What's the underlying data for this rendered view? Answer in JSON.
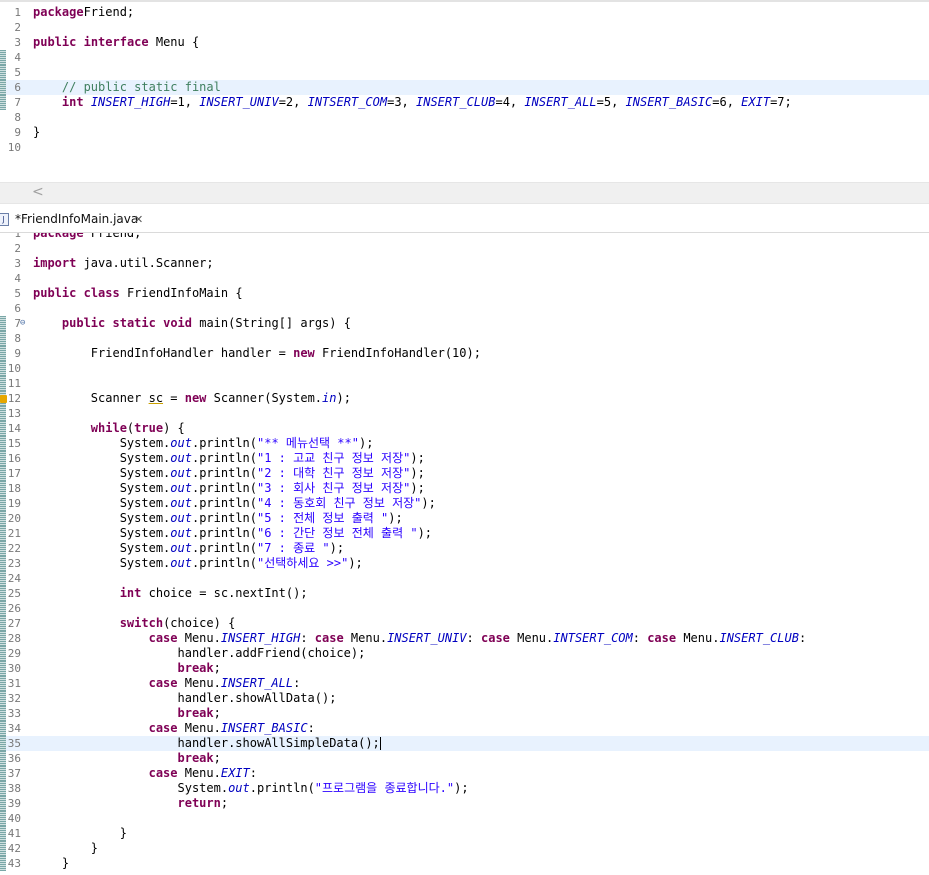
{
  "editor1": {
    "lines": [
      [
        [
          "kw",
          "package"
        ],
        [
          "",
          "Friend;"
        ]
      ],
      [],
      [
        [
          "kw",
          "public"
        ],
        [
          "",
          " "
        ],
        [
          "kw",
          "interface"
        ],
        [
          "",
          " Menu {"
        ]
      ],
      [],
      [],
      [
        [
          "",
          "    "
        ],
        [
          "cmt",
          "// public static final"
        ]
      ],
      [
        [
          "",
          "    "
        ],
        [
          "kw",
          "int"
        ],
        [
          "",
          " "
        ],
        [
          "fld",
          "INSERT_HIGH"
        ],
        [
          "",
          "=1, "
        ],
        [
          "fld",
          "INSERT_UNIV"
        ],
        [
          "",
          "=2, "
        ],
        [
          "fld",
          "INTSERT_COM"
        ],
        [
          "",
          "=3, "
        ],
        [
          "fld",
          "INSERT_CLUB"
        ],
        [
          "",
          "=4, "
        ],
        [
          "fld",
          "INSERT_ALL"
        ],
        [
          "",
          "=5, "
        ],
        [
          "fld",
          "INSERT_BASIC"
        ],
        [
          "",
          "=6, "
        ],
        [
          "fld",
          "EXIT"
        ],
        [
          "",
          "=7;"
        ]
      ],
      [],
      [
        [
          "",
          "}"
        ]
      ],
      []
    ]
  },
  "tab": {
    "file_label": "*FriendInfoMain.java",
    "file_icon": "J",
    "close_glyph": "✕"
  },
  "scroll": {
    "left_arrow": "<"
  },
  "editor2": {
    "lines": [
      [
        [
          "kw",
          "package"
        ],
        [
          "",
          " Friend;"
        ]
      ],
      [],
      [
        [
          "kw",
          "import"
        ],
        [
          "",
          " java.util.Scanner;"
        ]
      ],
      [],
      [
        [
          "kw",
          "public"
        ],
        [
          "",
          " "
        ],
        [
          "kw",
          "class"
        ],
        [
          "",
          " FriendInfoMain {"
        ]
      ],
      [],
      [
        [
          "",
          "    "
        ],
        [
          "kw",
          "public"
        ],
        [
          "",
          " "
        ],
        [
          "kw",
          "static"
        ],
        [
          "",
          " "
        ],
        [
          "kw",
          "void"
        ],
        [
          "",
          " main(String[] args) {"
        ]
      ],
      [],
      [
        [
          "",
          "        FriendInfoHandler handler = "
        ],
        [
          "kw",
          "new"
        ],
        [
          "",
          " FriendInfoHandler(10);"
        ]
      ],
      [],
      [],
      [
        [
          "",
          "        Scanner "
        ],
        [
          "ul",
          "sc"
        ],
        [
          "",
          " = "
        ],
        [
          "kw",
          "new"
        ],
        [
          "",
          " Scanner(System."
        ],
        [
          "fld",
          "in"
        ],
        [
          "",
          ");"
        ]
      ],
      [],
      [
        [
          "",
          "        "
        ],
        [
          "kw",
          "while"
        ],
        [
          "",
          "("
        ],
        [
          "kw",
          "true"
        ],
        [
          "",
          ") {"
        ]
      ],
      [
        [
          "",
          "            System."
        ],
        [
          "fld",
          "out"
        ],
        [
          "",
          ".println("
        ],
        [
          "str",
          "\"** 메뉴선택 **\""
        ],
        [
          "",
          ");"
        ]
      ],
      [
        [
          "",
          "            System."
        ],
        [
          "fld",
          "out"
        ],
        [
          "",
          ".println("
        ],
        [
          "str",
          "\"1 : 고교 친구 정보 저장\""
        ],
        [
          "",
          ");"
        ]
      ],
      [
        [
          "",
          "            System."
        ],
        [
          "fld",
          "out"
        ],
        [
          "",
          ".println("
        ],
        [
          "str",
          "\"2 : 대학 친구 정보 저장\""
        ],
        [
          "",
          ");"
        ]
      ],
      [
        [
          "",
          "            System."
        ],
        [
          "fld",
          "out"
        ],
        [
          "",
          ".println("
        ],
        [
          "str",
          "\"3 : 회사 친구 정보 저장\""
        ],
        [
          "",
          ");"
        ]
      ],
      [
        [
          "",
          "            System."
        ],
        [
          "fld",
          "out"
        ],
        [
          "",
          ".println("
        ],
        [
          "str",
          "\"4 : 동호회 친구 정보 저장\""
        ],
        [
          "",
          ");"
        ]
      ],
      [
        [
          "",
          "            System."
        ],
        [
          "fld",
          "out"
        ],
        [
          "",
          ".println("
        ],
        [
          "str",
          "\"5 : 전체 정보 출력 \""
        ],
        [
          "",
          ");"
        ]
      ],
      [
        [
          "",
          "            System."
        ],
        [
          "fld",
          "out"
        ],
        [
          "",
          ".println("
        ],
        [
          "str",
          "\"6 : 간단 정보 전체 출력 \""
        ],
        [
          "",
          ");"
        ]
      ],
      [
        [
          "",
          "            System."
        ],
        [
          "fld",
          "out"
        ],
        [
          "",
          ".println("
        ],
        [
          "str",
          "\"7 : 종료 \""
        ],
        [
          "",
          ");"
        ]
      ],
      [
        [
          "",
          "            System."
        ],
        [
          "fld",
          "out"
        ],
        [
          "",
          ".println("
        ],
        [
          "str",
          "\"선택하세요 >>\""
        ],
        [
          "",
          ");"
        ]
      ],
      [],
      [
        [
          "",
          "            "
        ],
        [
          "kw",
          "int"
        ],
        [
          "",
          " choice = sc.nextInt();"
        ]
      ],
      [],
      [
        [
          "",
          "            "
        ],
        [
          "kw",
          "switch"
        ],
        [
          "",
          "(choice) {"
        ]
      ],
      [
        [
          "",
          "                "
        ],
        [
          "kw",
          "case"
        ],
        [
          "",
          " Menu."
        ],
        [
          "fld",
          "INSERT_HIGH"
        ],
        [
          "",
          ": "
        ],
        [
          "kw",
          "case"
        ],
        [
          "",
          " Menu."
        ],
        [
          "fld",
          "INSERT_UNIV"
        ],
        [
          "",
          ": "
        ],
        [
          "kw",
          "case"
        ],
        [
          "",
          " Menu."
        ],
        [
          "fld",
          "INTSERT_COM"
        ],
        [
          "",
          ": "
        ],
        [
          "kw",
          "case"
        ],
        [
          "",
          " Menu."
        ],
        [
          "fld",
          "INSERT_CLUB"
        ],
        [
          "",
          ":"
        ]
      ],
      [
        [
          "",
          "                    handler.addFriend(choice);"
        ]
      ],
      [
        [
          "",
          "                    "
        ],
        [
          "kw",
          "break"
        ],
        [
          "",
          ";"
        ]
      ],
      [
        [
          "",
          "                "
        ],
        [
          "kw",
          "case"
        ],
        [
          "",
          " Menu."
        ],
        [
          "fld",
          "INSERT_ALL"
        ],
        [
          "",
          ":"
        ]
      ],
      [
        [
          "",
          "                    handler.showAllData();"
        ]
      ],
      [
        [
          "",
          "                    "
        ],
        [
          "kw",
          "break"
        ],
        [
          "",
          ";"
        ]
      ],
      [
        [
          "",
          "                "
        ],
        [
          "kw",
          "case"
        ],
        [
          "",
          " Menu."
        ],
        [
          "fld",
          "INSERT_BASIC"
        ],
        [
          "",
          ":"
        ]
      ],
      [
        [
          "",
          "                    handler.showAllSimpleData();"
        ]
      ],
      [
        [
          "",
          "                    "
        ],
        [
          "kw",
          "break"
        ],
        [
          "",
          ";"
        ]
      ],
      [
        [
          "",
          "                "
        ],
        [
          "kw",
          "case"
        ],
        [
          "",
          " Menu."
        ],
        [
          "fld",
          "EXIT"
        ],
        [
          "",
          ":"
        ]
      ],
      [
        [
          "",
          "                    System."
        ],
        [
          "fld",
          "out"
        ],
        [
          "",
          ".println("
        ],
        [
          "str",
          "\"프로그램을 종료합니다.\""
        ],
        [
          "",
          ");"
        ]
      ],
      [
        [
          "",
          "                    "
        ],
        [
          "kw",
          "return"
        ],
        [
          "",
          ";"
        ]
      ],
      [],
      [
        [
          "",
          "            }"
        ]
      ],
      [
        [
          "",
          "        }"
        ]
      ],
      [
        [
          "",
          "    }"
        ]
      ]
    ]
  }
}
